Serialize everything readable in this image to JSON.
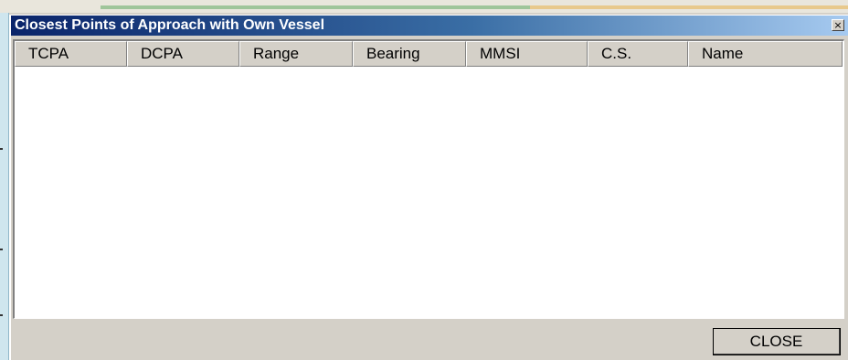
{
  "window": {
    "title": "Closest Points of Approach with Own Vessel",
    "close_glyph": "×"
  },
  "table": {
    "columns": [
      "TCPA",
      "DCPA",
      "Range",
      "Bearing",
      "MMSI",
      "C.S.",
      "Name"
    ],
    "rows": []
  },
  "buttons": {
    "close_label": "CLOSE"
  },
  "colors": {
    "titlebar_start": "#0a246a",
    "titlebar_end": "#a6caf0",
    "face": "#d4d0c8",
    "list_background": "#ffffff"
  }
}
